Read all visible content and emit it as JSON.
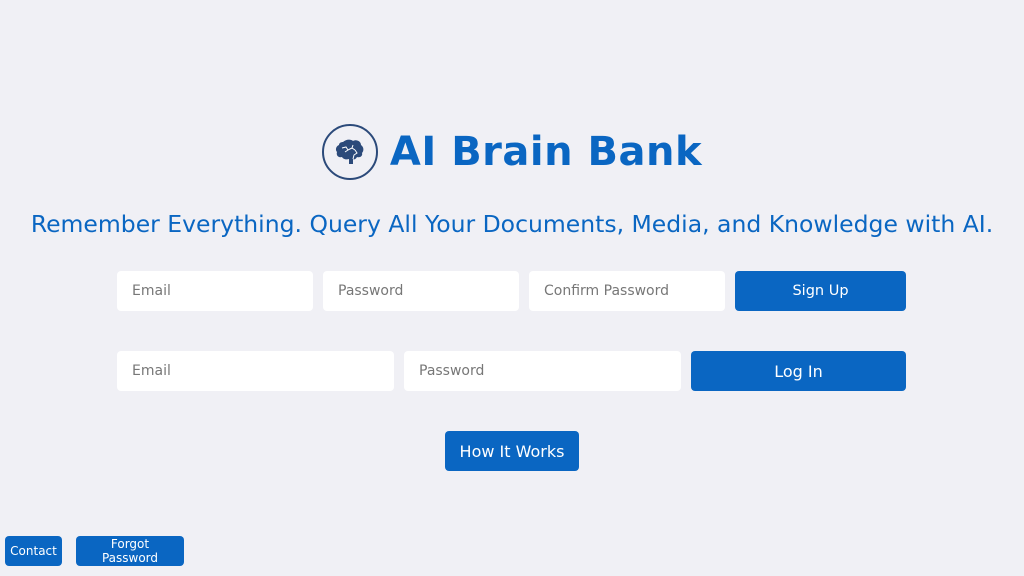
{
  "header": {
    "logo_icon": "brain-icon",
    "title": "AI Brain Bank",
    "tagline": "Remember Everything. Query All Your Documents, Media, and Knowledge with AI."
  },
  "signup": {
    "email_placeholder": "Email",
    "email_value": "",
    "password_placeholder": "Password",
    "password_value": "",
    "confirm_placeholder": "Confirm Password",
    "confirm_value": "",
    "button_label": "Sign Up"
  },
  "login": {
    "email_placeholder": "Email",
    "email_value": "",
    "password_placeholder": "Password",
    "password_value": "",
    "button_label": "Log In"
  },
  "how_it_works_label": "How It Works",
  "footer": {
    "contact_label": "Contact",
    "forgot_label": "Forgot Password"
  },
  "colors": {
    "accent": "#0a66c2",
    "background": "#f0f0f5",
    "logo_ring": "#2c4a7a"
  }
}
